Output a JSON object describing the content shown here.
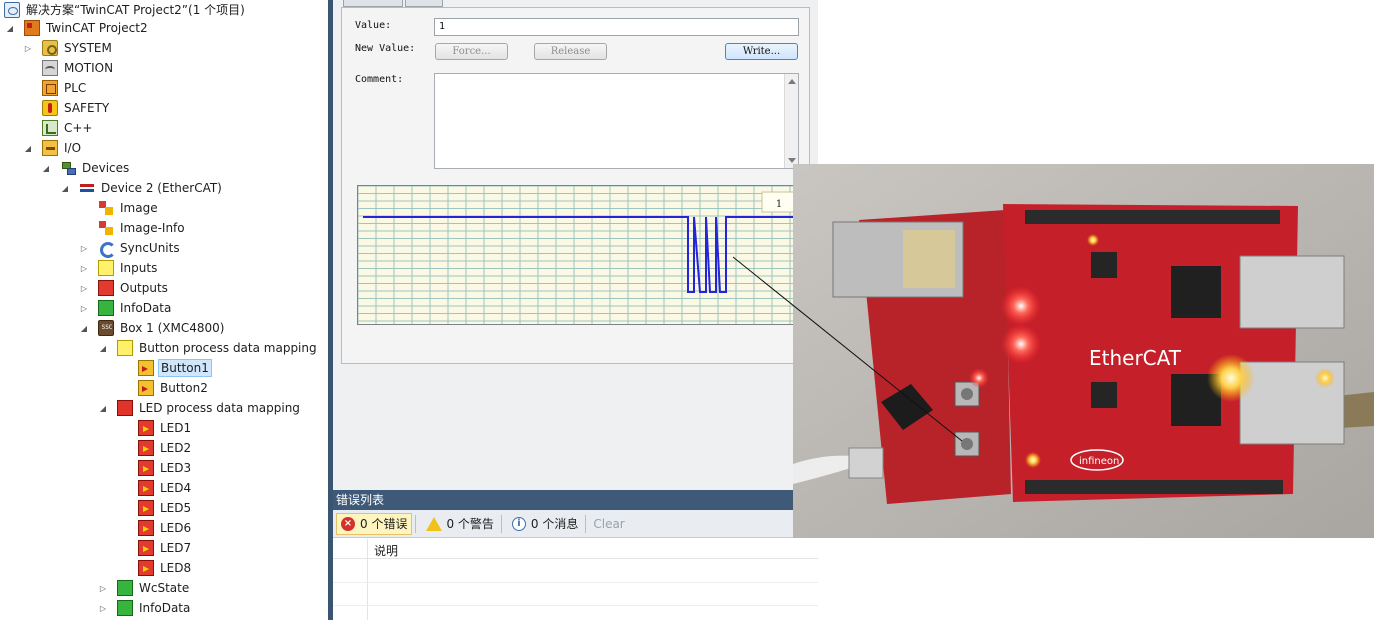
{
  "solution_explorer": {
    "items": [
      {
        "label": "解决方案“TwinCAT Project2”(1 个项目)",
        "icon": "solution-icon"
      },
      {
        "label": "TwinCAT Project2",
        "icon": "project-icon"
      },
      {
        "label": "SYSTEM",
        "icon": "system-icon"
      },
      {
        "label": "MOTION",
        "icon": "motion-icon"
      },
      {
        "label": "PLC",
        "icon": "plc-icon"
      },
      {
        "label": "SAFETY",
        "icon": "safety-icon"
      },
      {
        "label": "C++",
        "icon": "cpp-icon"
      },
      {
        "label": "I/O",
        "icon": "io-icon"
      },
      {
        "label": "Devices",
        "icon": "devices-icon"
      },
      {
        "label": "Device 2 (EtherCAT)",
        "icon": "ethercat-device-icon"
      },
      {
        "label": "Image",
        "icon": "image-icon"
      },
      {
        "label": "Image-Info",
        "icon": "image-info-icon"
      },
      {
        "label": "SyncUnits",
        "icon": "syncunits-icon"
      },
      {
        "label": "Inputs",
        "icon": "inputs-icon"
      },
      {
        "label": "Outputs",
        "icon": "outputs-icon"
      },
      {
        "label": "InfoData",
        "icon": "infodata-icon"
      },
      {
        "label": "Box 1 (XMC4800)",
        "icon": "box-icon"
      },
      {
        "label": "Button process data mapping",
        "icon": "input-mapping-icon"
      },
      {
        "label": "Button1",
        "icon": "input-variable-icon"
      },
      {
        "label": "Button2",
        "icon": "input-variable-icon"
      },
      {
        "label": "LED process data mapping",
        "icon": "output-mapping-icon"
      },
      {
        "label": "LED1",
        "icon": "output-variable-icon"
      },
      {
        "label": "LED2",
        "icon": "output-variable-icon"
      },
      {
        "label": "LED3",
        "icon": "output-variable-icon"
      },
      {
        "label": "LED4",
        "icon": "output-variable-icon"
      },
      {
        "label": "LED5",
        "icon": "output-variable-icon"
      },
      {
        "label": "LED6",
        "icon": "output-variable-icon"
      },
      {
        "label": "LED7",
        "icon": "output-variable-icon"
      },
      {
        "label": "LED8",
        "icon": "output-variable-icon"
      },
      {
        "label": "WcState",
        "icon": "wcstate-icon"
      },
      {
        "label": "InfoData",
        "icon": "infodata-icon"
      }
    ]
  },
  "online": {
    "value_label": "Value:",
    "value": "1",
    "new_value_label": "New Value:",
    "force_label": "Force...",
    "release_label": "Release",
    "write_label": "Write...",
    "comment_label": "Comment:",
    "comment": "",
    "chart_level": "1"
  },
  "error_list": {
    "title": "错误列表",
    "errors_label": "0 个错误",
    "warnings_label": "0 个警告",
    "messages_label": "0 个消息",
    "clear_label": "Clear",
    "column_description": "说明"
  },
  "colors": {
    "accent": "#3f5a78",
    "signal": "#2424d8",
    "selection": "#cfe6fb"
  }
}
